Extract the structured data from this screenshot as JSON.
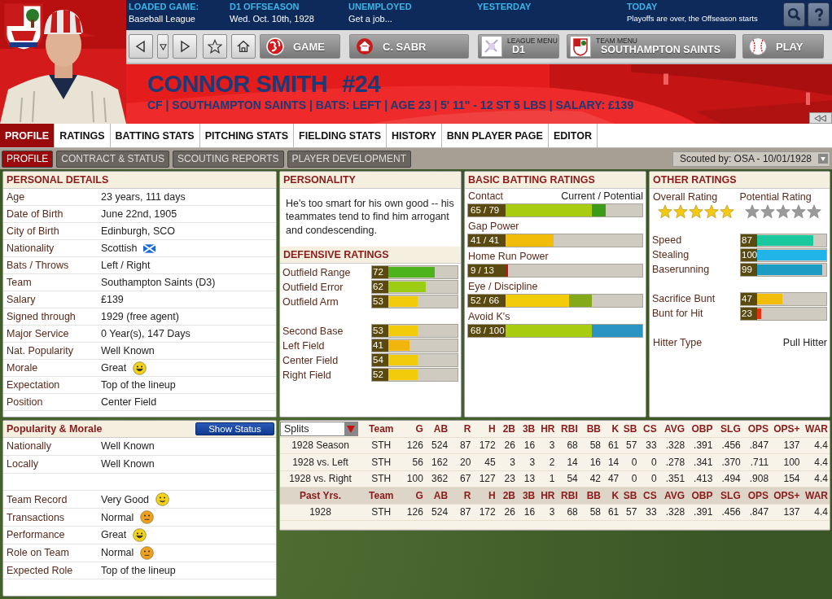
{
  "info_bar": [
    {
      "label": "LOADED GAME:",
      "value": "Baseball League"
    },
    {
      "label": "D1 OFFSEASON",
      "value": "Wed. Oct. 10th, 1928"
    },
    {
      "label": "UNEMPLOYED",
      "value": "Get a job..."
    },
    {
      "label": "YESTERDAY"
    },
    {
      "label": "TODAY",
      "value": "Playoffs are over, the Offseason starts",
      "kind": "small"
    }
  ],
  "nav": {
    "game": "GAME",
    "manager": "C. SABR",
    "league_menu": {
      "caption": "LEAGUE MENU",
      "value": "D1"
    },
    "team_menu": {
      "caption": "TEAM MENU",
      "value": "SOUTHAMPTON SAINTS"
    },
    "play": "PLAY"
  },
  "player": {
    "name": "CONNOR SMITH",
    "number": "#24",
    "summary": "CF | SOUTHAMPTON SAINTS | BATS: LEFT | AGE 23 | 5' 11\" - 12 ST 5 LBS | SALARY: £139"
  },
  "tabs": [
    {
      "label": "PROFILE",
      "selected": true
    },
    {
      "label": "RATINGS",
      "selected": false
    },
    {
      "label": "BATTING STATS",
      "selected": false
    },
    {
      "label": "PITCHING STATS",
      "selected": false
    },
    {
      "label": "FIELDING STATS",
      "selected": false
    },
    {
      "label": "HISTORY",
      "selected": false
    },
    {
      "label": "BNN PLAYER PAGE",
      "selected": false
    },
    {
      "label": "EDITOR",
      "selected": false
    }
  ],
  "subtabs": [
    {
      "label": "PROFILE",
      "selected": true
    },
    {
      "label": "CONTRACT & STATUS",
      "selected": false
    },
    {
      "label": "SCOUTING REPORTS",
      "selected": false
    },
    {
      "label": "PLAYER DEVELOPMENT",
      "selected": false
    }
  ],
  "scouted_by": "Scouted by: OSA - 10/01/1928",
  "personal_details": {
    "title": "PERSONAL DETAILS",
    "rows": [
      {
        "label": "Age",
        "value": "23 years, 111 days",
        "kind": "text"
      },
      {
        "label": "Date of Birth",
        "value": "June 22nd, 1905",
        "kind": "text"
      },
      {
        "label": "City of Birth",
        "value": "Edinburgh, SCO",
        "kind": "text"
      },
      {
        "label": "Nationality",
        "value": "Scottish",
        "kind": "flag"
      },
      {
        "label": "Bats / Throws",
        "value": "Left / Right",
        "kind": "text"
      },
      {
        "label": "Team",
        "value": "Southampton Saints (D3)",
        "kind": "text"
      },
      {
        "label": "Salary",
        "value": "£139",
        "kind": "text"
      },
      {
        "label": "Signed through",
        "value": "1929 (free agent)",
        "kind": "text"
      },
      {
        "label": "Major Service",
        "value": "0 Year(s), 147 Days",
        "kind": "text"
      },
      {
        "label": "Nat. Popularity",
        "value": "Well Known",
        "kind": "text"
      },
      {
        "label": "Morale",
        "value": "Great",
        "kind": "great"
      },
      {
        "label": "Expectation",
        "value": "Top of the lineup",
        "kind": "text"
      },
      {
        "label": "Position",
        "value": "Center Field",
        "kind": "text"
      }
    ]
  },
  "personality": {
    "title": "PERSONALITY",
    "text": "He's too smart for his own good -- his teammates tend to find him arrogant and condescending."
  },
  "defensive_ratings": {
    "title": "DEFENSIVE RATINGS",
    "groups": [
      [
        {
          "label": "Outfield Range",
          "reading": "72",
          "level": 0.73,
          "color": "#4cb41a"
        },
        {
          "label": "Outfield Error",
          "reading": "62",
          "level": 0.63,
          "color": "#9ccc14"
        },
        {
          "label": "Outfield Arm",
          "reading": "53",
          "level": 0.53,
          "color": "#f2cc0a"
        }
      ],
      [
        {
          "label": "Second Base",
          "reading": "53",
          "level": 0.53,
          "color": "#f2cc0a"
        },
        {
          "label": "Left Field",
          "reading": "41",
          "level": 0.44,
          "color": "#f0b40a"
        },
        {
          "label": "Center Field",
          "reading": "54",
          "level": 0.53,
          "color": "#f2cc0a"
        },
        {
          "label": "Right Field",
          "reading": "52",
          "level": 0.53,
          "color": "#f2cc0a"
        }
      ]
    ]
  },
  "batting_ratings": {
    "title": "BASIC BATTING RATINGS",
    "legend": "Current / Potential",
    "items": [
      {
        "label": "Contact",
        "reading": "65 / 79",
        "current": {
          "level": 0.71,
          "color": "#a8cc10"
        },
        "potential": {
          "level": 0.79,
          "color": "#3c9c1a"
        }
      },
      {
        "label": "Gap Power",
        "reading": "41 / 41",
        "current": {
          "level": 0.49,
          "color": "#f2bc0a"
        }
      },
      {
        "label": "Home Run Power",
        "reading": "9 / 13",
        "current": {
          "level": 0.23,
          "color": "#c81010"
        }
      },
      {
        "label": "Eye / Discipline",
        "reading": "52 / 66",
        "current": {
          "level": 0.58,
          "color": "#f2cc0a"
        },
        "potential": {
          "level": 0.71,
          "color": "#84aa1a"
        }
      },
      {
        "label": "Avoid K's",
        "reading": "68 / 100",
        "current": {
          "level": 0.71,
          "color": "#a8cc10"
        },
        "potential": {
          "level": 1.0,
          "color": "#2a94c4"
        }
      }
    ]
  },
  "other_ratings": {
    "title": "OTHER RATINGS",
    "overall": {
      "label": "Overall Rating",
      "stars": 5,
      "kind": "gold"
    },
    "potential": {
      "label": "Potential Rating",
      "stars": 5,
      "kind": "grey"
    },
    "groups": [
      [
        {
          "label": "Speed",
          "reading": "87",
          "level": 0.85,
          "color": "#1ac8a0"
        },
        {
          "label": "Stealing",
          "reading": "100",
          "level": 1.0,
          "color": "#20b4e8"
        },
        {
          "label": "Baserunning",
          "reading": "99",
          "level": 0.95,
          "color": "#1a9cc4"
        }
      ],
      [
        {
          "label": "Sacrifice Bunt",
          "reading": "47",
          "level": 0.49,
          "color": "#f2bc0a"
        },
        {
          "label": "Bunt for Hit",
          "reading": "23",
          "level": 0.24,
          "color": "#e8300a"
        }
      ]
    ],
    "hitter_type": {
      "label": "Hitter Type",
      "value": "Pull Hitter"
    }
  },
  "popularity": {
    "title": "Popularity & Morale",
    "button": "Show Status",
    "groups": [
      [
        {
          "label": "Nationally",
          "value": "Well Known",
          "kind": "text"
        },
        {
          "label": "Locally",
          "value": "Well Known",
          "kind": "text"
        }
      ],
      [
        {
          "label": "Team Record",
          "value": "Very Good",
          "kind": "good"
        },
        {
          "label": "Transactions",
          "value": "Normal",
          "kind": "normal"
        },
        {
          "label": "Performance",
          "value": "Great",
          "kind": "great"
        },
        {
          "label": "Role on Team",
          "value": "Normal",
          "kind": "normal"
        },
        {
          "label": "Expected Role",
          "value": "Top of the lineup",
          "kind": "text"
        }
      ]
    ]
  },
  "stats": {
    "columns": [
      "Splits",
      "Team",
      "G",
      "AB",
      "R",
      "H",
      "2B",
      "3B",
      "HR",
      "RBI",
      "BB",
      "K",
      "SB",
      "CS",
      "AVG",
      "OBP",
      "SLG",
      "OPS",
      "OPS+",
      "WAR"
    ],
    "rows": [
      [
        "1928 Season",
        "STH",
        "126",
        "524",
        "87",
        "172",
        "26",
        "16",
        "3",
        "68",
        "58",
        "61",
        "57",
        "33",
        ".328",
        ".391",
        ".456",
        ".847",
        "137",
        "4.4"
      ],
      [
        "1928 vs. Left",
        "STH",
        "56",
        "162",
        "20",
        "45",
        "3",
        "3",
        "2",
        "14",
        "16",
        "14",
        "0",
        "0",
        ".278",
        ".341",
        ".370",
        ".711",
        "100",
        "4.4"
      ],
      [
        "1928 vs. Right",
        "STH",
        "100",
        "362",
        "67",
        "127",
        "23",
        "13",
        "1",
        "54",
        "42",
        "47",
        "0",
        "0",
        ".351",
        ".413",
        ".494",
        ".908",
        "154",
        "4.4"
      ]
    ],
    "past_columns": [
      "Past Yrs.",
      "Team",
      "G",
      "AB",
      "R",
      "H",
      "2B",
      "3B",
      "HR",
      "RBI",
      "BB",
      "K",
      "SB",
      "CS",
      "AVG",
      "OBP",
      "SLG",
      "OPS",
      "OPS+",
      "WAR"
    ],
    "past_rows": [
      [
        "1928",
        "STH",
        "126",
        "524",
        "87",
        "172",
        "26",
        "16",
        "3",
        "68",
        "58",
        "61",
        "57",
        "33",
        ".328",
        ".391",
        ".456",
        ".847",
        "137",
        "4.4"
      ]
    ]
  }
}
